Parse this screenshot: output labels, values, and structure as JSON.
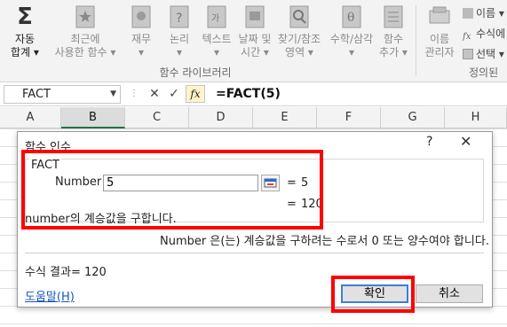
{
  "ribbon": {
    "autosum": {
      "line1": "자동",
      "line2": "합계 ▾"
    },
    "buttons": [
      {
        "line1": "최근에",
        "line2": "사용한 함수 ▾"
      },
      {
        "line1": "재무",
        "line2": "▾"
      },
      {
        "line1": "논리",
        "line2": "▾"
      },
      {
        "line1": "텍스트",
        "line2": "▾"
      },
      {
        "line1": "날짜 및",
        "line2": "시간 ▾"
      },
      {
        "line1": "찾기/참조",
        "line2": "영역 ▾"
      },
      {
        "line1": "수학/삼각",
        "line2": "▾"
      },
      {
        "line1": "함수",
        "line2": "추가 ▾"
      },
      {
        "line1": "이름",
        "line2": "관리자"
      }
    ],
    "group_label": "함수 라이브러리",
    "group_label2": "정의된",
    "small_items": [
      "이름 ▾",
      "수식에",
      "선택 ▾"
    ]
  },
  "formula_bar": {
    "name_box": "FACT",
    "cancel": "✕",
    "enter": "✓",
    "fx": "fx",
    "formula": "=FACT(5)"
  },
  "columns": [
    {
      "label": "A",
      "selected": false
    },
    {
      "label": "B",
      "selected": true
    },
    {
      "label": "C",
      "selected": false
    },
    {
      "label": "D",
      "selected": false
    },
    {
      "label": "E",
      "selected": false
    },
    {
      "label": "F",
      "selected": false
    },
    {
      "label": "G",
      "selected": false
    },
    {
      "label": "H",
      "selected": false
    }
  ],
  "dialog": {
    "title": "함수 인수",
    "help": "?",
    "close": "✕",
    "function_name": "FACT",
    "argument_label": "Number",
    "argument_value": "5",
    "argument_equals": "=",
    "argument_result": "5",
    "result_equals": "=",
    "result": "120",
    "description": "number의 계승값을 구합니다.",
    "argument_description": "Number  은(는) 계승값을 구하려는 수로서 0 또는 양수여야 합니다.",
    "formula_result": "수식 결과=  120",
    "help_link": "도움말(H)",
    "ok": "확인",
    "cancel": "취소"
  },
  "colors": {
    "highlight": "#ff0000",
    "selected_col_accent": "#217346",
    "link": "#1a56b8"
  }
}
